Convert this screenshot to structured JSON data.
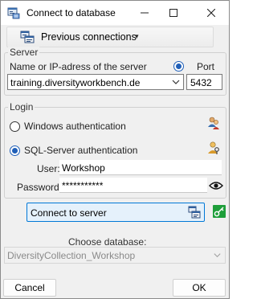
{
  "window": {
    "title": "Connect to database",
    "minimize_glyph": "—",
    "maximize_glyph": "☐",
    "close_glyph": "✕"
  },
  "toolbar": {
    "previous_connections_label": "Previous connections",
    "caret": "▾"
  },
  "server": {
    "group_title": "Server",
    "name_label": "Name or IP-adress of the server",
    "port_label": "Port",
    "server_value": "training.diversityworkbench.de",
    "port_value": "5432",
    "port_radio_checked": true
  },
  "login": {
    "group_title": "Login",
    "windows_auth_label": "Windows authentication",
    "windows_auth_checked": false,
    "sql_auth_label": "SQL-Server authentication",
    "sql_auth_checked": true,
    "user_label": "User:",
    "user_value": "Workshop",
    "password_label": "Password:",
    "password_value": "***********"
  },
  "actions": {
    "connect_label": "Connect to server",
    "choose_db_label": "Choose database:",
    "database_value": "DiversityCollection_Workshop",
    "cancel_label": "Cancel",
    "ok_label": "OK"
  },
  "icons": {
    "app": "database-window-icon",
    "previous_connections": "database-connections-icon",
    "windows_auth": "windows-users-icon",
    "sql_auth": "sql-user-key-icon",
    "show_password": "eye-icon",
    "connect": "server-connect-icon",
    "key": "green-key-icon"
  },
  "colors": {
    "accent": "#0078d7",
    "connect_bg": "#e5f1fb",
    "radio_selected": "#1f5fb8",
    "key_green": "#1e9e3a"
  }
}
